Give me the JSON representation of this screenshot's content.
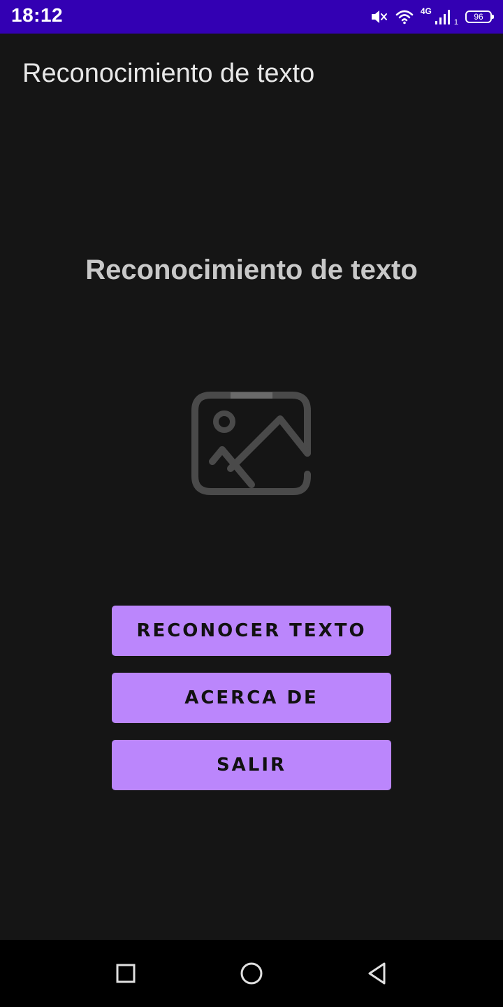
{
  "status_bar": {
    "time": "18:12",
    "network_label": "4G",
    "sim_label": "1",
    "battery_level": "96",
    "icons": [
      "mute-icon",
      "wifi-icon",
      "signal-icon",
      "battery-icon"
    ],
    "background_color": "#3300b3"
  },
  "app_bar": {
    "title": "Reconocimiento de texto"
  },
  "main": {
    "heading": "Reconocimiento de texto",
    "image_icon": "image-placeholder-icon",
    "buttons": [
      {
        "label": "RECONOCER TEXTO"
      },
      {
        "label": "ACERCA DE"
      },
      {
        "label": "SALIR"
      }
    ],
    "button_color": "#bb86fc"
  },
  "nav_bar": {
    "icons": [
      "recent-apps-icon",
      "home-icon",
      "back-icon"
    ]
  }
}
